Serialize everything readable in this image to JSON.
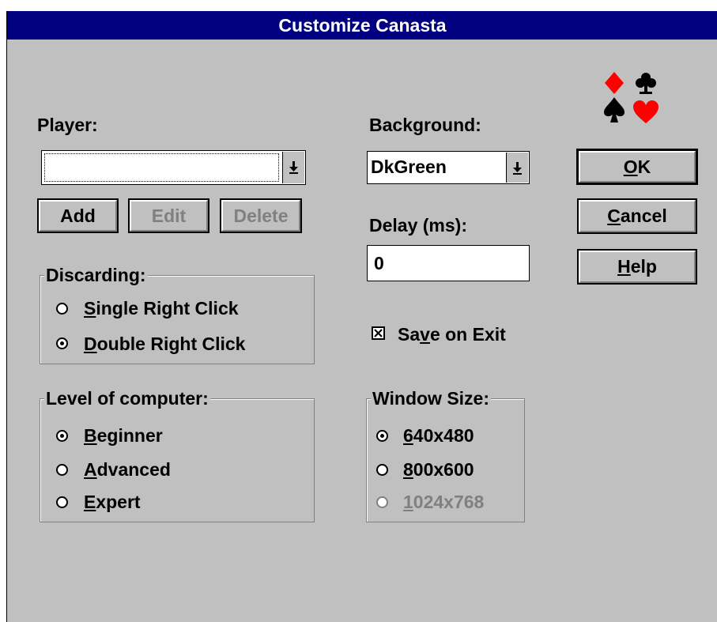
{
  "window": {
    "title": "Customize Canasta"
  },
  "player": {
    "label": "Player:",
    "value": ""
  },
  "player_buttons": {
    "add": "Add",
    "edit": "Edit",
    "delete": "Delete"
  },
  "background": {
    "label": "Background:",
    "value": "DkGreen"
  },
  "delay": {
    "label": "Delay (ms):",
    "value": "0"
  },
  "save_on_exit": {
    "label_pre": "Sa",
    "label_key": "v",
    "label_post": "e on Exit",
    "checked": true
  },
  "buttons": {
    "ok": {
      "key": "O",
      "rest": "K"
    },
    "cancel": {
      "key": "C",
      "rest": "ancel"
    },
    "help": {
      "key": "H",
      "rest": "elp"
    }
  },
  "discarding": {
    "label": "Discarding:",
    "options": [
      {
        "key": "S",
        "rest": "ingle Right Click",
        "selected": false
      },
      {
        "key": "D",
        "rest": "ouble Right Click",
        "selected": true
      }
    ]
  },
  "level": {
    "label": "Level of computer:",
    "options": [
      {
        "key": "B",
        "rest": "eginner",
        "selected": true
      },
      {
        "key": "A",
        "rest": "dvanced",
        "selected": false
      },
      {
        "key": "E",
        "rest": "xpert",
        "selected": false
      }
    ]
  },
  "window_size": {
    "label": "Window Size:",
    "options": [
      {
        "key": "6",
        "rest": "40x480",
        "selected": true,
        "enabled": true
      },
      {
        "key": "8",
        "rest": "00x600",
        "selected": false,
        "enabled": true
      },
      {
        "key": "1",
        "rest": "024x768",
        "selected": false,
        "enabled": false
      }
    ]
  },
  "suit_icons": [
    "diamond-icon",
    "club-icon",
    "spade-icon",
    "heart-icon"
  ],
  "colors": {
    "title_bg": "#000080",
    "face": "#c0c0c0",
    "red_suit": "#ff0000"
  }
}
